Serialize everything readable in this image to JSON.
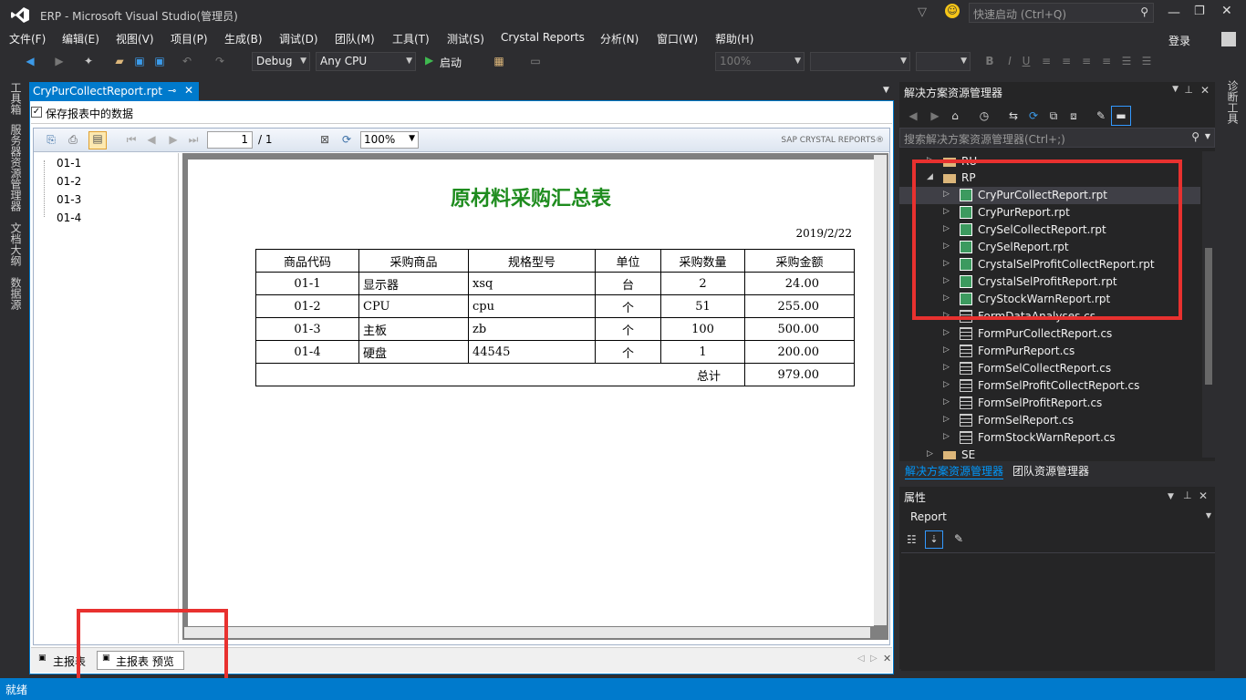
{
  "window": {
    "title": "ERP - Microsoft Visual Studio(管理员)",
    "quick_launch_placeholder": "快速启动 (Ctrl+Q)",
    "login": "登录"
  },
  "menu": [
    "文件(F)",
    "编辑(E)",
    "视图(V)",
    "项目(P)",
    "生成(B)",
    "调试(D)",
    "团队(M)",
    "工具(T)",
    "测试(S)",
    "Crystal Reports",
    "分析(N)",
    "窗口(W)",
    "帮助(H)"
  ],
  "toolbar": {
    "config": "Debug",
    "platform": "Any CPU",
    "start": "启动",
    "zoom": "100%"
  },
  "left_tabs": [
    "工具箱",
    "服务器资源管理器",
    "文档大纲",
    "数据源"
  ],
  "right_tabs": [
    "诊断工具"
  ],
  "document": {
    "tab_title": "CryPurCollectReport.rpt",
    "save_data_label": "保存报表中的数据",
    "viewer": {
      "page": "1",
      "page_total": "/ 1",
      "zoom": "100%",
      "brand": "SAP CRYSTAL REPORTS®"
    },
    "tree_items": [
      "01-1",
      "01-2",
      "01-3",
      "01-4"
    ],
    "bottom_tabs": [
      "主报表",
      "主报表 预览"
    ]
  },
  "report": {
    "title": "原材料采购汇总表",
    "date": "2019/2/22",
    "headers": [
      "商品代码",
      "采购商品",
      "规格型号",
      "单位",
      "采购数量",
      "采购金额"
    ],
    "rows": [
      [
        "01-1",
        "显示器",
        "xsq",
        "台",
        "2",
        "24.00"
      ],
      [
        "01-2",
        "CPU",
        "cpu",
        "个",
        "51",
        "255.00"
      ],
      [
        "01-3",
        "主板",
        "zb",
        "个",
        "100",
        "500.00"
      ],
      [
        "01-4",
        "硬盘",
        "44545",
        "个",
        "1",
        "200.00"
      ]
    ],
    "total_label": "总计",
    "total_value": "979.00"
  },
  "solution_explorer": {
    "title": "解决方案资源管理器",
    "search_placeholder": "搜索解决方案资源管理器(Ctrl+;)",
    "items": [
      {
        "label": "RU",
        "level": 0,
        "type": "folder"
      },
      {
        "label": "RP",
        "level": 0,
        "type": "folder-open"
      },
      {
        "label": "CryPurCollectReport.rpt",
        "level": 1,
        "type": "rpt",
        "selected": true
      },
      {
        "label": "CryPurReport.rpt",
        "level": 1,
        "type": "rpt"
      },
      {
        "label": "CrySelCollectReport.rpt",
        "level": 1,
        "type": "rpt"
      },
      {
        "label": "CrySelReport.rpt",
        "level": 1,
        "type": "rpt"
      },
      {
        "label": "CrystalSelProfitCollectReport.rpt",
        "level": 1,
        "type": "rpt"
      },
      {
        "label": "CrystalSelProfitReport.rpt",
        "level": 1,
        "type": "rpt"
      },
      {
        "label": "CryStockWarnReport.rpt",
        "level": 1,
        "type": "rpt"
      },
      {
        "label": "FormDataAnalyses.cs",
        "level": 1,
        "type": "cs"
      },
      {
        "label": "FormPurCollectReport.cs",
        "level": 1,
        "type": "cs"
      },
      {
        "label": "FormPurReport.cs",
        "level": 1,
        "type": "cs"
      },
      {
        "label": "FormSelCollectReport.cs",
        "level": 1,
        "type": "cs"
      },
      {
        "label": "FormSelProfitCollectReport.cs",
        "level": 1,
        "type": "cs"
      },
      {
        "label": "FormSelProfitReport.cs",
        "level": 1,
        "type": "cs"
      },
      {
        "label": "FormSelReport.cs",
        "level": 1,
        "type": "cs"
      },
      {
        "label": "FormStockWarnReport.cs",
        "level": 1,
        "type": "cs"
      },
      {
        "label": "SE",
        "level": 0,
        "type": "folder"
      }
    ],
    "bottom_tabs": [
      "解决方案资源管理器",
      "团队资源管理器"
    ]
  },
  "properties": {
    "title": "属性",
    "object": "Report"
  },
  "status": {
    "text": "就绪"
  },
  "colors": {
    "accent": "#007acc",
    "highlight": "#e8312f",
    "report_title": "#1e8c1e"
  }
}
